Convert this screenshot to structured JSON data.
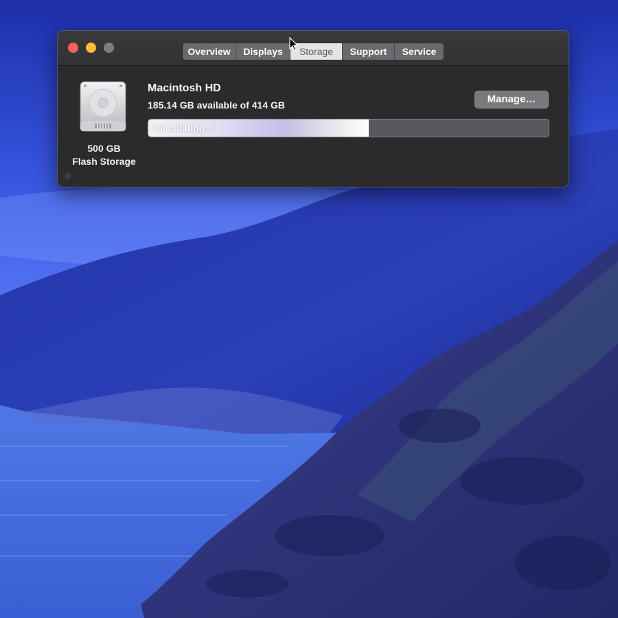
{
  "window": {
    "tabs": [
      {
        "label": "Overview"
      },
      {
        "label": "Displays"
      },
      {
        "label": "Storage"
      },
      {
        "label": "Support"
      },
      {
        "label": "Service"
      }
    ],
    "selected_tab": "Storage"
  },
  "disk": {
    "icon": "hard-drive-icon",
    "size": "500 GB",
    "type": "Flash Storage"
  },
  "volume": {
    "name": "Macintosh HD",
    "available": "185.14 GB available of 414 GB",
    "bar_label": "Calculating…",
    "bar_progress": 0.55
  },
  "actions": {
    "manage_label": "Manage…"
  },
  "colors": {
    "close": "#ff5f57",
    "minimize": "#febc2e",
    "zoom": "#7d7d82",
    "window_bg": "#2b2b2d"
  }
}
